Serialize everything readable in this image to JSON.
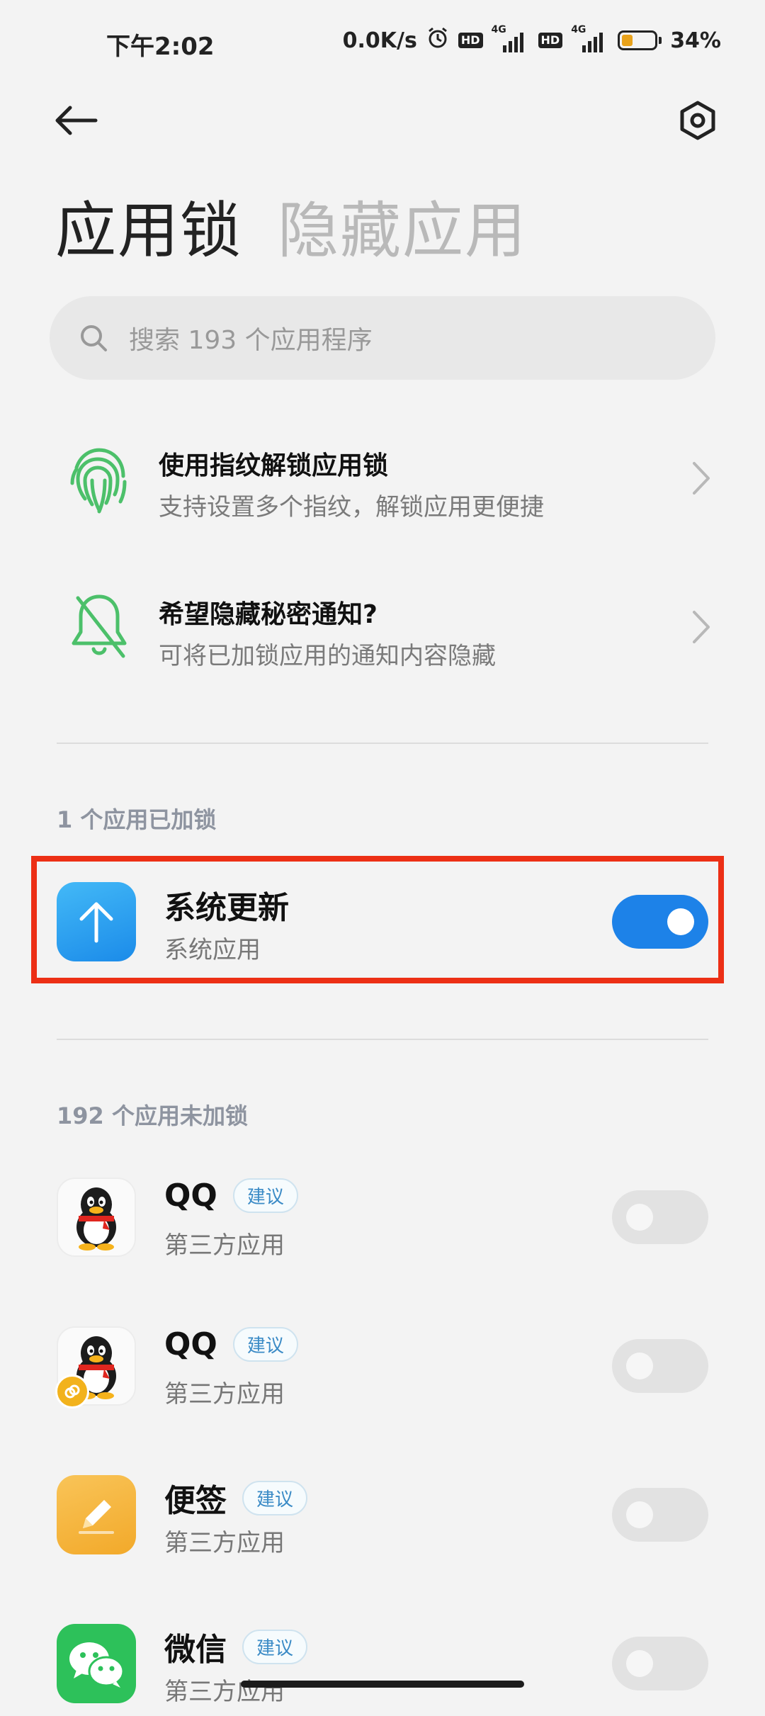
{
  "status_bar": {
    "time": "下午2:02",
    "net_speed": "0.0K/s",
    "hd1": "HD",
    "net1": "4G",
    "hd2": "HD",
    "net2": "4G",
    "battery_percent": 34,
    "battery_label": "34%"
  },
  "header": {
    "tab_active": "应用锁",
    "tab_inactive": "隐藏应用"
  },
  "search": {
    "placeholder": "搜索 193 个应用程序"
  },
  "tips": [
    {
      "title": "使用指纹解锁应用锁",
      "subtitle": "支持设置多个指纹，解锁应用更便捷",
      "icon": "fingerprint-icon"
    },
    {
      "title": "希望隐藏秘密通知?",
      "subtitle": "可将已加锁应用的通知内容隐藏",
      "icon": "bell-off-icon"
    }
  ],
  "locked_section": {
    "label": "1 个应用已加锁",
    "apps": [
      {
        "name": "系统更新",
        "category": "系统应用",
        "locked": true,
        "icon": "system-update-icon"
      }
    ]
  },
  "unlocked_section": {
    "label": "192 个应用未加锁",
    "apps": [
      {
        "name": "QQ",
        "badge": "建议",
        "category": "第三方应用",
        "locked": false,
        "icon": "qq-icon"
      },
      {
        "name": "QQ",
        "badge": "建议",
        "category": "第三方应用",
        "locked": false,
        "icon": "qq-clone-icon"
      },
      {
        "name": "便签",
        "badge": "建议",
        "category": "第三方应用",
        "locked": false,
        "icon": "notes-icon"
      },
      {
        "name": "微信",
        "badge": "建议",
        "category": "第三方应用",
        "locked": false,
        "icon": "wechat-icon"
      }
    ]
  },
  "colors": {
    "accent": "#1d82e8",
    "highlight": "#ec2f15",
    "fingerprint_green": "#4cc06a",
    "notes_yellow": "#f6b73c",
    "wechat_green": "#2dc15a"
  }
}
